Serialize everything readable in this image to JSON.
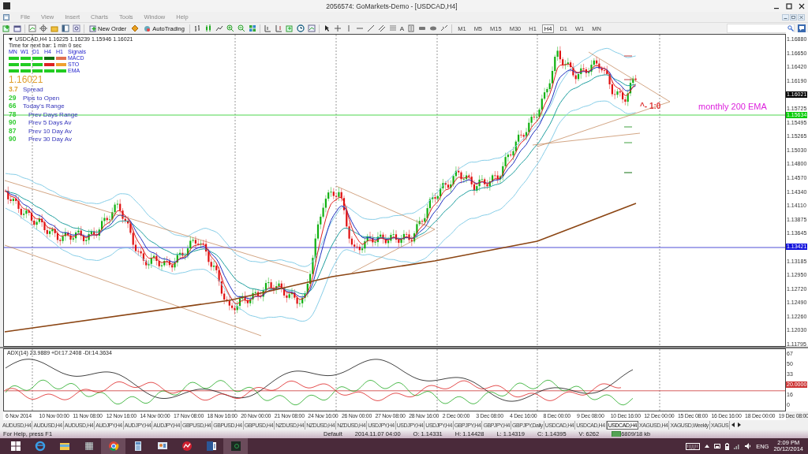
{
  "window": {
    "title": "2056574: GoMarkets-Demo - [USDCAD,H4]"
  },
  "menu": [
    "File",
    "View",
    "Insert",
    "Charts",
    "Tools",
    "Window",
    "Help"
  ],
  "toolbar": {
    "buttons": [
      {
        "label": "New Order"
      },
      {
        "label": "AutoTrading"
      }
    ],
    "text_tool": "A",
    "timeframes": [
      {
        "label": "M1",
        "selected": false
      },
      {
        "label": "M5",
        "selected": false
      },
      {
        "label": "M15",
        "selected": false
      },
      {
        "label": "M30",
        "selected": false
      },
      {
        "label": "H1",
        "selected": false
      },
      {
        "label": "H4",
        "selected": true
      },
      {
        "label": "D1",
        "selected": false
      },
      {
        "label": "W1",
        "selected": false
      },
      {
        "label": "MN",
        "selected": false
      }
    ]
  },
  "chart": {
    "header": "USDCAD,H4  1.16225 1.16239 1.15946 1.16021",
    "timer": "Time for next bar: 1 min 0 sec",
    "signals": {
      "columns": [
        "MN",
        "W1",
        "D1",
        "H4",
        "H1"
      ],
      "title": "Signals",
      "rows": [
        {
          "label": "MACD",
          "cells": [
            {
              "color": "#22cc22"
            },
            {
              "color": "#22cc22"
            },
            {
              "color": "#22cc22"
            },
            {
              "color": "#107010"
            },
            {
              "color": "#e07050"
            }
          ]
        },
        {
          "label": "STO",
          "cells": [
            {
              "color": "#22cc22"
            },
            {
              "color": "#22cc22"
            },
            {
              "color": "#22cc22"
            },
            {
              "color": "#dd2222"
            },
            {
              "color": "#f0a030"
            }
          ]
        },
        {
          "label": "EMA",
          "cells": [
            {
              "color": "#22cc22"
            },
            {
              "color": "#22cc22"
            },
            {
              "color": "#22cc22"
            },
            {
              "color": "#22cc22"
            },
            {
              "color": "#22cc22"
            }
          ]
        }
      ]
    },
    "price": "1.16021",
    "stats": [
      {
        "value": "3.7",
        "label": "Spread",
        "kind": "main",
        "color": "#e0a030"
      },
      {
        "value": "29",
        "label": "Pips to Open",
        "kind": "main",
        "color": "#33cc33"
      },
      {
        "value": "66",
        "label": "Today's Range",
        "kind": "main",
        "color": "#33cc33"
      },
      {
        "value": "78",
        "label": "Prev Days Range",
        "kind": "sub",
        "color": "#33cc33"
      },
      {
        "value": "90",
        "label": "Prev 5 Days Av",
        "kind": "sub",
        "color": "#33cc33"
      },
      {
        "value": "87",
        "label": "Prev 10 Day Av",
        "kind": "sub",
        "color": "#33cc33"
      },
      {
        "value": "90",
        "label": "Prev 30 Day Av",
        "kind": "sub",
        "color": "#33cc33"
      }
    ],
    "annotations": [
      {
        "kind": "marker",
        "text": "^- 1:0",
        "color": "#dd3333"
      },
      {
        "kind": "label",
        "text": "monthly 200 EMA",
        "color": "#dd22dd"
      }
    ],
    "price_axis": [
      {
        "text": "1.16880",
        "kind": "tick"
      },
      {
        "text": "1.16650",
        "kind": "tick"
      },
      {
        "text": "1.16420",
        "kind": "tick"
      },
      {
        "text": "1.16190",
        "kind": "tick"
      },
      {
        "text": "1.16021",
        "kind": "box",
        "color": "#000000"
      },
      {
        "text": "1.15725",
        "kind": "tick"
      },
      {
        "text": "1.15634",
        "kind": "marker",
        "color": "#00cc00"
      },
      {
        "text": "1.15495",
        "kind": "tick"
      },
      {
        "text": "1.15265",
        "kind": "tick"
      },
      {
        "text": "1.15030",
        "kind": "tick"
      },
      {
        "text": "1.14800",
        "kind": "tick"
      },
      {
        "text": "1.14570",
        "kind": "tick"
      },
      {
        "text": "1.14340",
        "kind": "tick"
      },
      {
        "text": "1.14110",
        "kind": "tick"
      },
      {
        "text": "1.13875",
        "kind": "tick"
      },
      {
        "text": "1.13645",
        "kind": "tick"
      },
      {
        "text": "1.13421",
        "kind": "box",
        "color": "#1010dd"
      },
      {
        "text": "1.13185",
        "kind": "tick"
      },
      {
        "text": "1.12950",
        "kind": "tick"
      },
      {
        "text": "1.12720",
        "kind": "tick"
      },
      {
        "text": "1.12490",
        "kind": "tick"
      },
      {
        "text": "1.12260",
        "kind": "tick"
      },
      {
        "text": "1.12030",
        "kind": "tick"
      },
      {
        "text": "1.11795",
        "kind": "tick"
      }
    ],
    "indicator": {
      "title": "ADX(14) 23.9889 +DI:17.2408 -DI:14.3634",
      "axis": [
        {
          "text": "67",
          "kind": "tick"
        },
        {
          "text": "50",
          "kind": "tick"
        },
        {
          "text": "33",
          "kind": "tick"
        },
        {
          "text": "20.0000",
          "kind": "box",
          "color": "#cc3333"
        },
        {
          "text": "16",
          "kind": "tick"
        },
        {
          "text": "0",
          "kind": "tick"
        }
      ]
    },
    "time_axis": [
      "6 Nov 2014",
      "10 Nov 00:00",
      "11 Nov 08:00",
      "12 Nov 16:00",
      "14 Nov 00:00",
      "17 Nov 08:00",
      "18 Nov 16:00",
      "20 Nov 00:00",
      "21 Nov 08:00",
      "24 Nov 16:00",
      "26 Nov 00:00",
      "27 Nov 08:00",
      "28 Nov 16:00",
      "2 Dec 00:00",
      "3 Dec 08:00",
      "4 Dec 16:00",
      "8 Dec 00:00",
      "9 Dec 08:00",
      "10 Dec 16:00",
      "12 Dec 00:00",
      "15 Dec 08:00",
      "16 Dec 16:00",
      "18 Dec 00:00",
      "19 Dec 08:00"
    ]
  },
  "tabs": [
    {
      "label": "AUDUSD,H4",
      "selected": false
    },
    {
      "label": "AUDUSD,H4",
      "selected": false
    },
    {
      "label": "AUDUSD,H4",
      "selected": false
    },
    {
      "label": "AUDJPY,H4",
      "selected": false
    },
    {
      "label": "AUDJPY,H4",
      "selected": false
    },
    {
      "label": "AUDJPY,H4",
      "selected": false
    },
    {
      "label": "GBPUSD,H4",
      "selected": false
    },
    {
      "label": "GBPUSD,H4",
      "selected": false
    },
    {
      "label": "GBPUSD,H4",
      "selected": false
    },
    {
      "label": "NZDUSD,H4",
      "selected": false
    },
    {
      "label": "NZDUSD,H4",
      "selected": false
    },
    {
      "label": "NZDUSD,H4",
      "selected": false
    },
    {
      "label": "USDJPY,H4",
      "selected": false
    },
    {
      "label": "USDJPY,H4",
      "selected": false
    },
    {
      "label": "USDJPY,H4",
      "selected": false
    },
    {
      "label": "GBPJPY,H4",
      "selected": false
    },
    {
      "label": "GBPJPY,H4",
      "selected": false
    },
    {
      "label": "GBPJPY,Daily",
      "selected": false
    },
    {
      "label": "USDCAD,H4",
      "selected": false
    },
    {
      "label": "USDCAD,H4",
      "selected": false
    },
    {
      "label": "USDCAD,H4",
      "selected": true
    },
    {
      "label": "XAGUSD,H4",
      "selected": false
    },
    {
      "label": "XAGUSD,Weekly",
      "selected": false
    },
    {
      "label": "XAGUS",
      "selected": false
    }
  ],
  "status_bar": {
    "help": "For Help, press F1",
    "profile": "Default",
    "time": "2014.11.07 04:00",
    "open": "O: 1.14331",
    "high": "H: 1.14428",
    "low": "L: 1.14319",
    "close": "C: 1.14395",
    "volume": "V: 6262",
    "traffic": "6809/18 kb"
  },
  "taskbar": {
    "language": "ENG",
    "time": "2:09 PM",
    "date": "20/12/2014"
  }
}
